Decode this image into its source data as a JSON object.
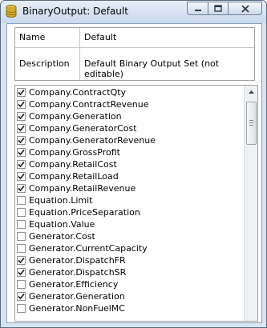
{
  "window": {
    "title": "BinaryOutput: Default",
    "icon": "database-icon",
    "minimize_icon": "minimize-icon",
    "maximize_icon": "maximize-icon",
    "close_icon": "close-icon"
  },
  "properties": [
    {
      "name": "Name",
      "value": "Default"
    },
    {
      "name": "Description",
      "value": "Default Binary Output Set (not editable)"
    }
  ],
  "items": [
    {
      "label": "Company.ContractQty",
      "checked": true
    },
    {
      "label": "Company.ContractRevenue",
      "checked": true
    },
    {
      "label": "Company.Generation",
      "checked": true
    },
    {
      "label": "Company.GeneratorCost",
      "checked": true
    },
    {
      "label": "Company.GeneratorRevenue",
      "checked": true
    },
    {
      "label": "Company.GrossProfit",
      "checked": true
    },
    {
      "label": "Company.RetailCost",
      "checked": true
    },
    {
      "label": "Company.RetailLoad",
      "checked": true
    },
    {
      "label": "Company.RetailRevenue",
      "checked": true
    },
    {
      "label": "Equation.Limit",
      "checked": false
    },
    {
      "label": "Equation.PriceSeparation",
      "checked": false
    },
    {
      "label": "Equation.Value",
      "checked": false
    },
    {
      "label": "Generator.Cost",
      "checked": false
    },
    {
      "label": "Generator.CurrentCapacity",
      "checked": false
    },
    {
      "label": "Generator.DispatchFR",
      "checked": true
    },
    {
      "label": "Generator.DispatchSR",
      "checked": true
    },
    {
      "label": "Generator.Efficiency",
      "checked": false
    },
    {
      "label": "Generator.Generation",
      "checked": true
    },
    {
      "label": "Generator.NonFuelMC",
      "checked": false
    }
  ],
  "scrollbar": {
    "up_icon": "scroll-up-icon",
    "down_icon": "scroll-down-icon"
  }
}
